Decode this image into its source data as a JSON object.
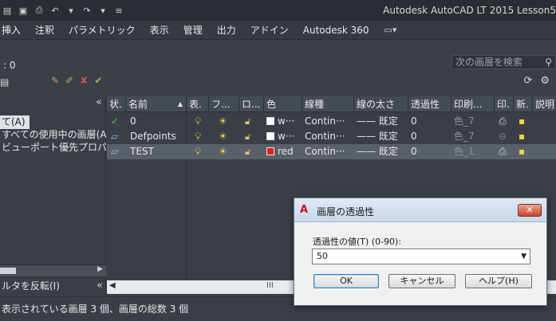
{
  "titlebar": {
    "title": "Autodesk AutoCAD LT 2015    Lesson5"
  },
  "ribbon_tabs": [
    "挿入",
    "注釈",
    "パラメトリック",
    "表示",
    "管理",
    "出力",
    "アドイン",
    "Autodesk 360"
  ],
  "layer_manager": {
    "current_layer": ": 0",
    "search_placeholder": "次の画層を検索",
    "filter_tree": {
      "all_label": "て(A)",
      "all_used_label": "すべての使用中の画層(A)",
      "viewport_override_label": "ビューポート優先プロパ",
      "invert_filter_label": "ルタを反転(I)"
    },
    "columns": [
      "状.",
      "名前",
      "表.",
      "フ...",
      "ロ...",
      "色",
      "線種",
      "線の太さ",
      "透過性",
      "印刷...",
      "印.",
      "新.",
      "説明"
    ],
    "rows": [
      {
        "status": "✓",
        "name": "0",
        "color_name": "w···",
        "color": "#ffffff",
        "linetype": "Contin···",
        "lineweight": "—— 既定",
        "transparency": "0",
        "plot_style": "色_7"
      },
      {
        "status": "",
        "name": "Defpoints",
        "color_name": "w···",
        "color": "#ffffff",
        "linetype": "Contin···",
        "lineweight": "—— 既定",
        "transparency": "0",
        "plot_style": "色_7"
      },
      {
        "status": "",
        "name": "TEST",
        "color_name": "red",
        "color": "#e0201b",
        "linetype": "Contin···",
        "lineweight": "—— 既定",
        "transparency": "0",
        "plot_style": "色_1"
      }
    ],
    "scroll_mid": "III",
    "status_text": "表示されている画層 3 個、画層の総数 3 個"
  },
  "dialog": {
    "title": "画層の透過性",
    "label": "透過性の値(T) (0-90):",
    "value": "50",
    "ok_label": "OK",
    "cancel_label": "キャンセル",
    "help_label": "ヘルプ(H)"
  }
}
